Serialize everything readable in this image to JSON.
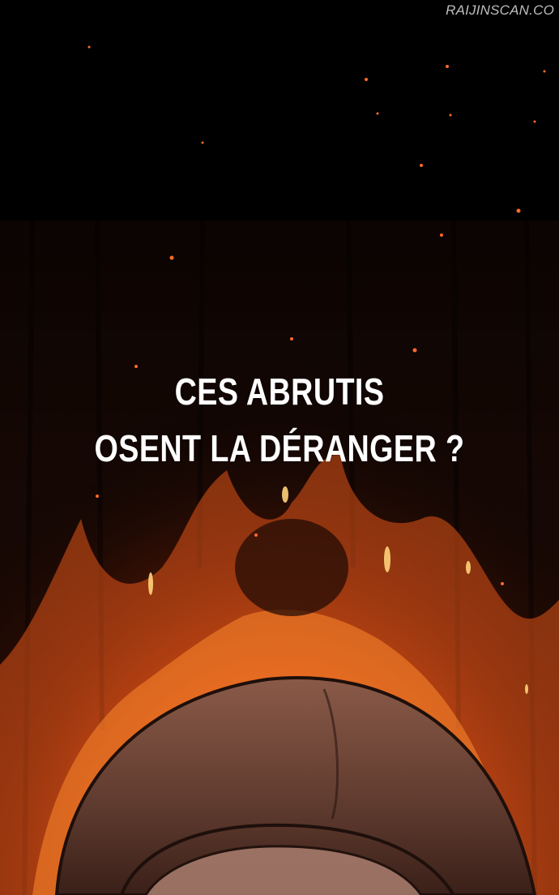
{
  "watermark": "RAIJINSCAN.CO",
  "caption": {
    "line1": "CES ABRUTIS",
    "line2": "OSENT LA DÉRANGER ?"
  }
}
